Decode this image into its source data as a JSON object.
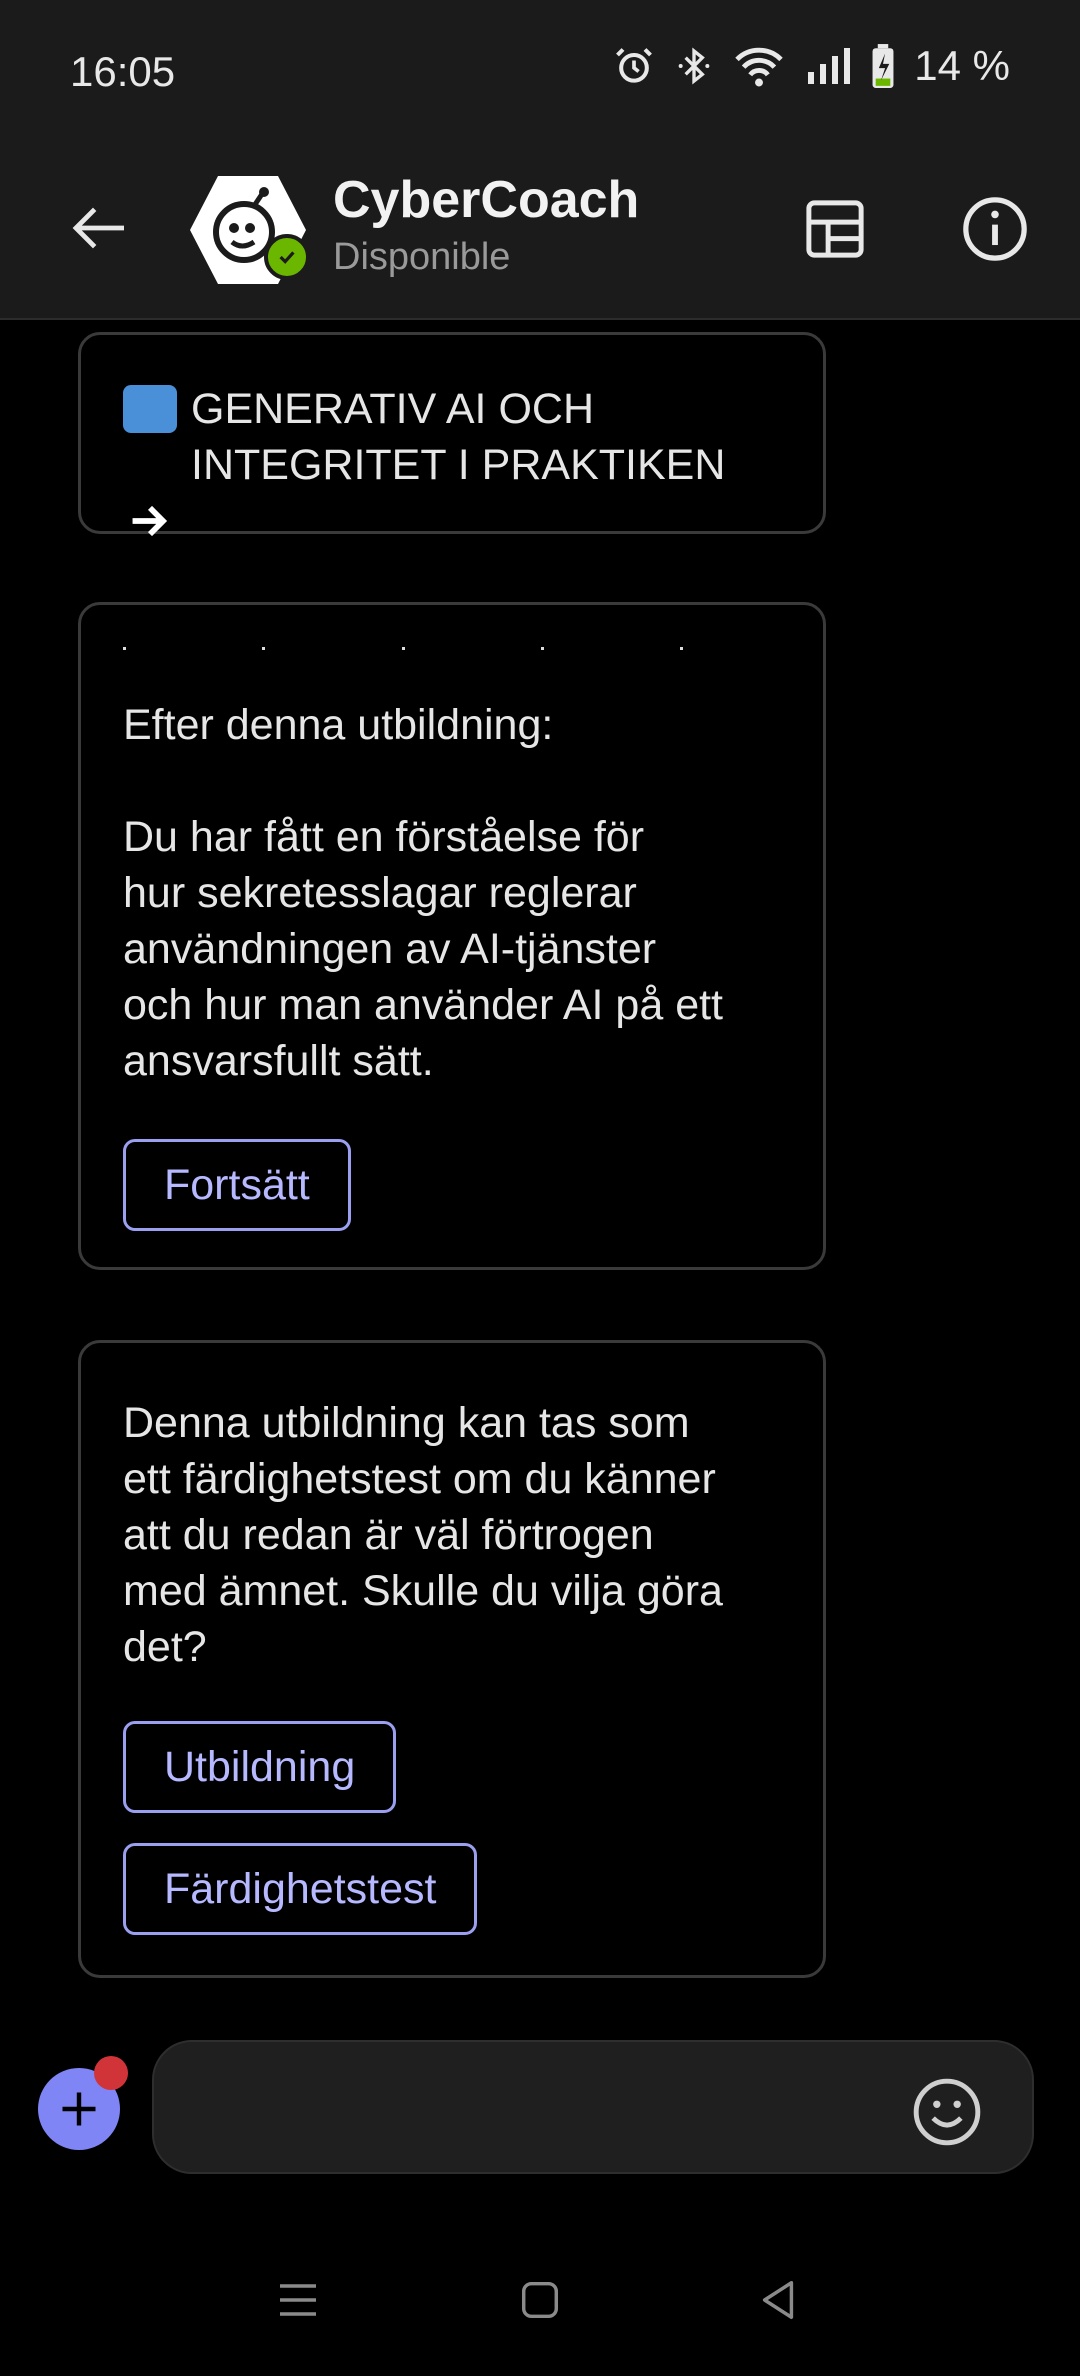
{
  "status": {
    "time": "16:05",
    "battery": "14 %"
  },
  "header": {
    "title": "CyberCoach",
    "subtitle": "Disponible"
  },
  "messages": [
    {
      "emoji": "➡️",
      "text": "GENERATIV AI OCH\nINTEGRITET I PRAKTIKEN"
    },
    {
      "text": "Efter denna utbildning:\n\nDu har fått en förståelse för\nhur sekretesslagar reglerar\nanvändningen av AI-tjänster\noch hur man använder AI på ett\nansvarsfullt sätt.",
      "button": "Fortsätt"
    },
    {
      "text": "Denna utbildning kan tas som\nett färdighetstest om du känner\natt du redan är väl förtrogen\nmed ämnet. Skulle du vilja göra\ndet?",
      "buttons": [
        "Utbildning",
        "Färdighetstest"
      ]
    }
  ],
  "colors": {
    "accent": "#7f85f5",
    "button_border": "#9a9ff0",
    "presence": "#6bb700",
    "notification": "#d13438"
  },
  "icons": [
    "back-arrow-icon",
    "bot-avatar-icon",
    "layout-icon",
    "info-icon",
    "plus-icon",
    "emoji-icon",
    "alarm-icon",
    "bluetooth-icon",
    "wifi-icon",
    "signal-icon",
    "battery-icon"
  ]
}
